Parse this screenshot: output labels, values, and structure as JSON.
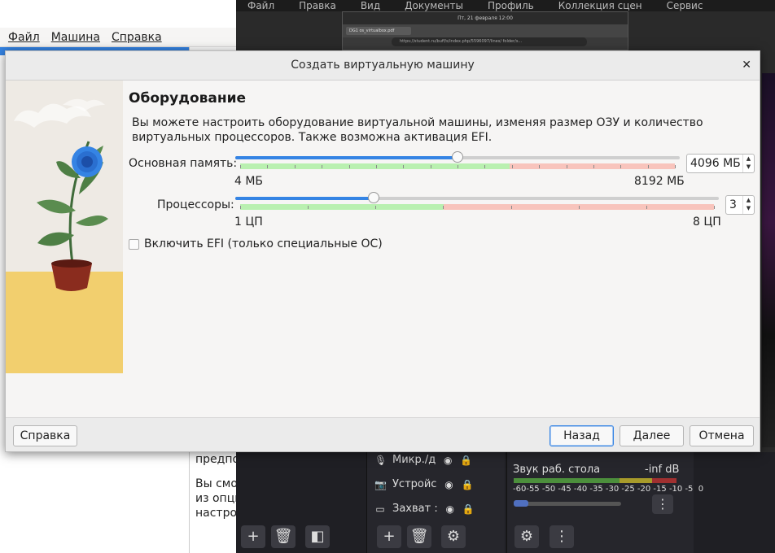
{
  "background": {
    "topbar_items": [
      "Файл",
      "Правка",
      "Вид",
      "Документы",
      "Профиль",
      "Коллекция сцен",
      "Сервис"
    ],
    "browser": {
      "clock": "Пт, 21 февраля 12:00",
      "tab_title": "DG1 os_virtualbox.pdf",
      "url": "https://student.ru/buff/s/index.php/5596097/lines/ folder/s..."
    },
    "vbox_menu": [
      "Файл",
      "Машина",
      "Справка"
    ],
    "vbox_text": [
      "предпо",
      "Вы смо",
      "из опци",
      "настро"
    ],
    "obs": {
      "sources": [
        "Микр./д",
        "Устройс",
        "Захват :"
      ],
      "mixer_label": "Звук раб. стола",
      "mixer_value": "-inf dB",
      "mixer_scale": "-60-55 -50 -45 -40 -35 -30 -25 -20 -15 -10 -5  0"
    }
  },
  "dialog": {
    "title": "Создать виртуальную машину",
    "heading": "Оборудование",
    "description": "Вы можете настроить оборудование виртуальной машины, изменяя размер ОЗУ и количество\nвиртуальных процессоров. Также возможна активация EFI.",
    "memory": {
      "label": "Основная память:",
      "value": "4096 МБ",
      "min_label": "4 МБ",
      "max_label": "8192 МБ",
      "position": 0.5,
      "safe_fraction": 0.62
    },
    "cpu": {
      "label": "Процессоры:",
      "value": "3",
      "min_label": "1 ЦП",
      "max_label": "8 ЦП",
      "position": 0.2857,
      "safe_fraction": 0.43
    },
    "efi": {
      "label": "Включить EFI (только специальные ОС)",
      "checked": false
    },
    "buttons": {
      "help": "Справка",
      "back": "Назад",
      "next": "Далее",
      "cancel": "Отмена"
    }
  },
  "colors": {
    "accent": "#3584e4",
    "safe_zone": "#b9f0b0",
    "risky_zone": "#f8c4bc"
  }
}
